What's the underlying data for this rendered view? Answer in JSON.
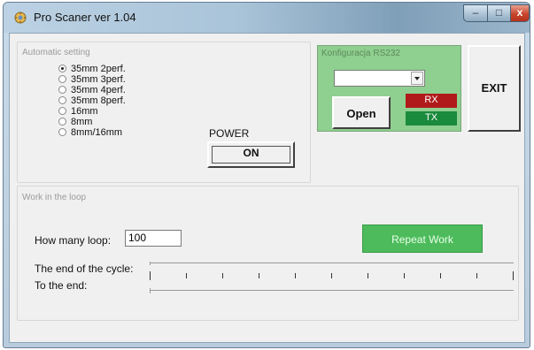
{
  "window": {
    "title": "Pro Scaner ver 1.04",
    "controls": {
      "minimize": "–",
      "maximize": "□",
      "close": "x"
    }
  },
  "auto": {
    "label": "Automatic setting",
    "options": [
      "35mm 2perf.",
      "35mm 3perf.",
      "35mm 4perf.",
      "35mm 8perf.",
      "16mm",
      "8mm",
      "8mm/16mm"
    ],
    "selected_index": 0,
    "power_label": "POWER",
    "on_label": "ON"
  },
  "rs232": {
    "label": "Konfiguracja RS232",
    "port_value": "",
    "open_label": "Open",
    "rx_label": "RX",
    "tx_label": "TX",
    "rx_color": "#b01a1a",
    "tx_color": "#1a8a3c",
    "panel_color": "#8fcf8f"
  },
  "exit_label": "EXIT",
  "loop": {
    "label": "Work in the loop",
    "how_many_label": "How many loop:",
    "how_many_value": "100",
    "repeat_label": "Repeat Work",
    "repeat_color": "#4dbb5c",
    "end_cycle_label": "The end of the cycle:",
    "to_end_label": "To the end:",
    "tick_count": 11
  }
}
